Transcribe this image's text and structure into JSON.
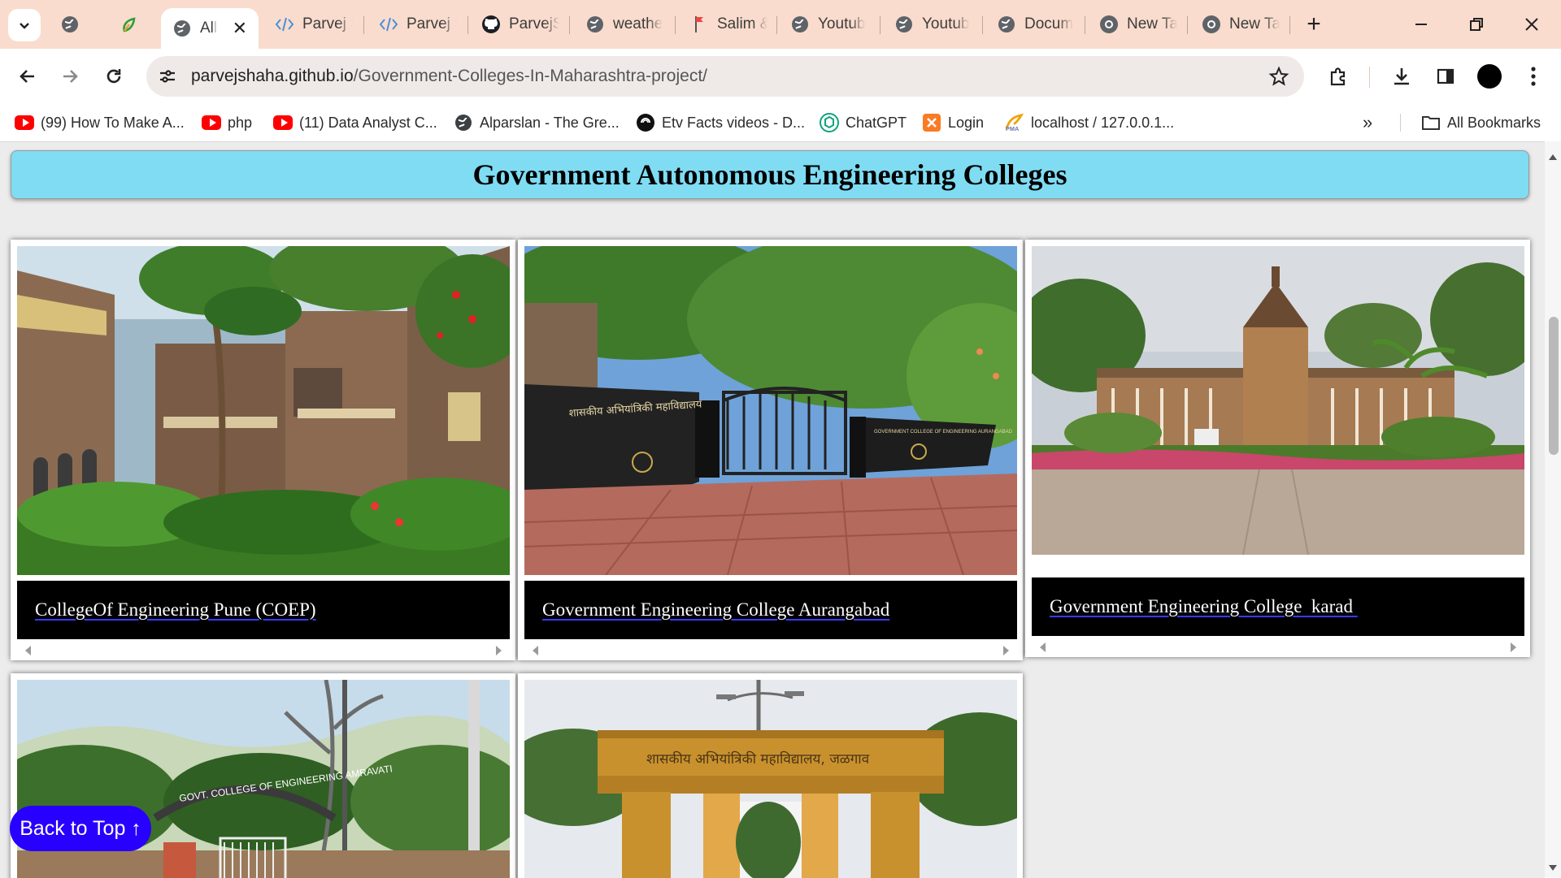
{
  "tabs": [
    {
      "label": "",
      "icon": "globe-icon"
    },
    {
      "label": "",
      "icon": "leaf-icon"
    },
    {
      "label": "All",
      "icon": "globe-icon",
      "active": true
    },
    {
      "label": "Parvej S",
      "icon": "code-icon"
    },
    {
      "label": "Parvej S",
      "icon": "code-icon"
    },
    {
      "label": "ParvejS",
      "icon": "github-icon"
    },
    {
      "label": "weathe",
      "icon": "globe-icon"
    },
    {
      "label": "Salim &",
      "icon": "flag-icon"
    },
    {
      "label": "Youtub",
      "icon": "globe-icon"
    },
    {
      "label": "Youtub",
      "icon": "globe-icon"
    },
    {
      "label": "Docum",
      "icon": "globe-icon"
    },
    {
      "label": "New Ta",
      "icon": "chrome-icon"
    },
    {
      "label": "New Ta",
      "icon": "chrome-icon"
    }
  ],
  "address": {
    "domain": "parvejshaha.github.io",
    "path": "/Government-Colleges-In-Maharashtra-project/"
  },
  "bookmarks": [
    {
      "label": "(99) How To Make A...",
      "icon": "youtube-icon"
    },
    {
      "label": "php",
      "icon": "youtube-icon"
    },
    {
      "label": "(11) Data Analyst C...",
      "icon": "youtube-icon"
    },
    {
      "label": "Alparslan - The Gre...",
      "icon": "globe-icon"
    },
    {
      "label": "Etv Facts videos - D...",
      "icon": "etv-icon"
    },
    {
      "label": "ChatGPT",
      "icon": "chatgpt-icon"
    },
    {
      "label": "Login",
      "icon": "xampp-icon"
    },
    {
      "label": "localhost / 127.0.0.1...",
      "icon": "pma-icon"
    }
  ],
  "all_bookmarks": "All Bookmarks",
  "page": {
    "heading": "Government Autonomous Engineering Colleges",
    "colleges": [
      {
        "name": "CollegeOf Engineering Pune (COEP)"
      },
      {
        "name": "Government Engineering College Aurangabad"
      },
      {
        "name": "Government Engineering College  karad "
      },
      {
        "name": ""
      },
      {
        "name": ""
      }
    ],
    "photo_texts": {
      "aurangabad_sign_left": "शासकीय अभियांत्रिकी महाविद्यालय",
      "aurangabad_sign_right": "GOVERNMENT COLLEGE OF ENGINEERING AURANGABAD",
      "amravati_arch": "GOVT. COLLEGE OF ENGINEERING AMRAVATI",
      "jalgaon_arch": "शासकीय अभियांत्रिकी महाविद्यालय, जळगाव"
    },
    "back_to_top": "Back to Top ↑"
  },
  "colors": {
    "tabstrip": "#f9dccd",
    "heading_bg": "#7fdcf3",
    "caption_bg": "#000000",
    "back_to_top_bg": "#2700ff"
  }
}
